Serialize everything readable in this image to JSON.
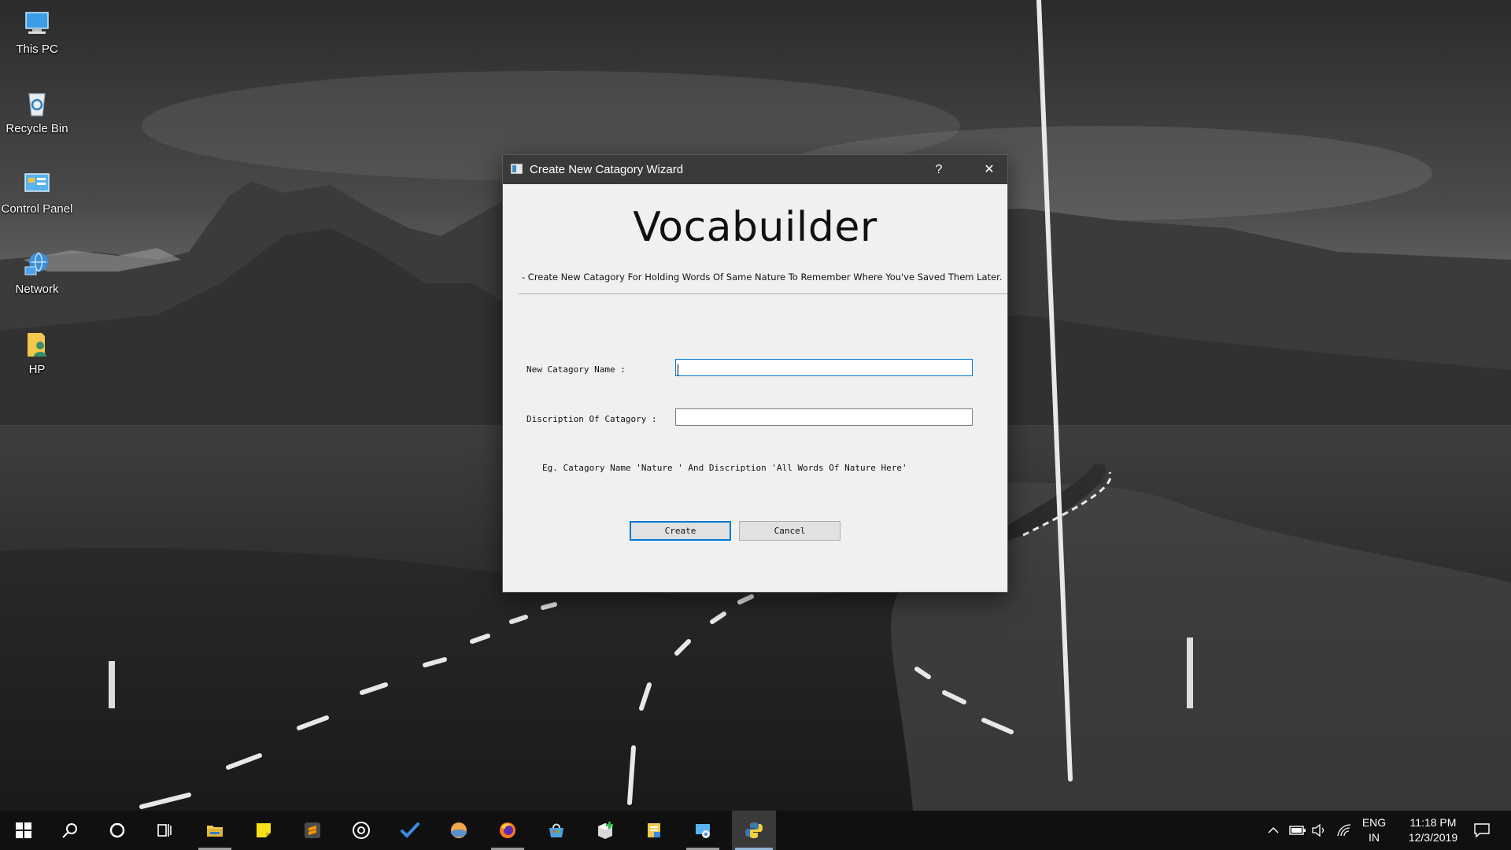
{
  "desktop": {
    "icons": [
      {
        "label": "This PC",
        "icon": "this-pc-icon"
      },
      {
        "label": "Recycle Bin",
        "icon": "recycle-bin-icon"
      },
      {
        "label": "Control Panel",
        "icon": "control-panel-icon"
      },
      {
        "label": "Network",
        "icon": "network-icon"
      },
      {
        "label": "HP",
        "icon": "user-folder-icon"
      }
    ]
  },
  "dialog": {
    "title": "Create New Catagory Wizard",
    "help_label": "?",
    "close_label": "✕",
    "heading": "Vocabuilder",
    "subtitle": "- Create New Catagory For Holding Words Of Same Nature To Remember Where You've Saved Them Later.",
    "name_label": "New Catagory Name :",
    "name_value": "",
    "desc_label": "Discription Of Catagory :",
    "desc_value": "",
    "example": "Eg. Catagory Name 'Nature ' And Discription 'All Words Of Nature Here'",
    "create_label": "Create",
    "cancel_label": "Cancel"
  },
  "taskbar": {
    "apps": [
      "start-icon",
      "search-icon",
      "cortana-icon",
      "task-view-icon",
      "file-explorer-icon",
      "sticky-notes-icon",
      "sublime-text-icon",
      "groove-music-icon",
      "todo-icon",
      "weather-icon",
      "firefox-icon",
      "store-icon",
      "app-installer-icon",
      "document-icon",
      "control-panel-icon",
      "python-icon"
    ],
    "active_app": "python-icon",
    "language_top": "ENG",
    "language_bottom": "IN",
    "time": "11:18 PM",
    "date": "12/3/2019"
  },
  "colors": {
    "accent": "#0078d7",
    "titlebar": "#3a3a3a",
    "dialog_bg": "#f0f0f0",
    "taskbar": "#101010"
  }
}
